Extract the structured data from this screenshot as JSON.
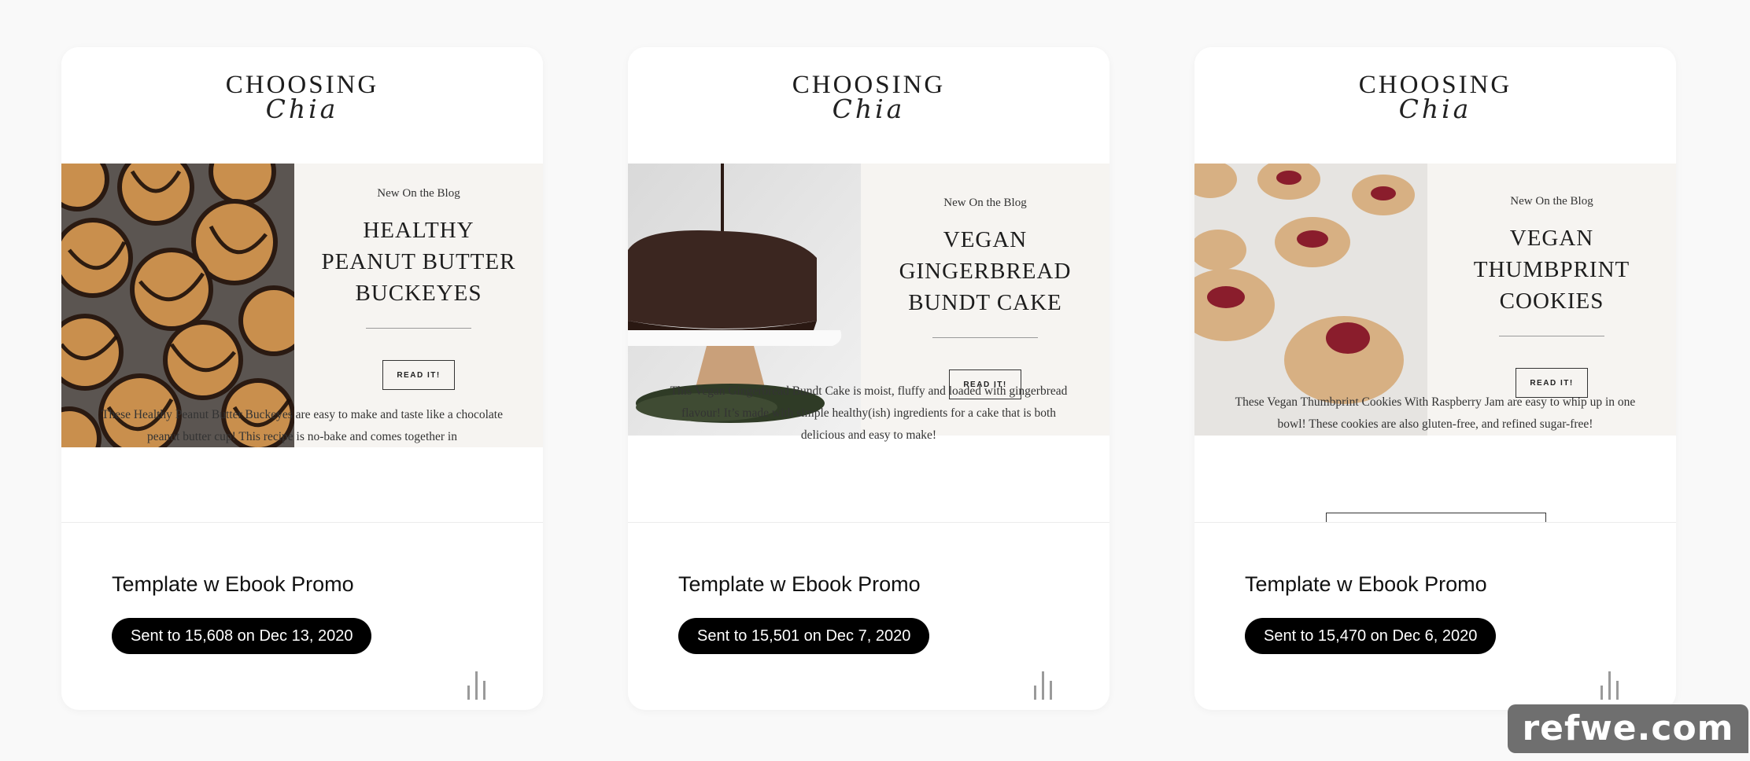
{
  "cards": [
    {
      "logo_word": "CHOOSING",
      "logo_script": "Chia",
      "kicker": "New On the Blog",
      "post_title": "HEALTHY PEANUT BUTTER BUCKEYES",
      "read_label": "READ IT!",
      "excerpt": "These Healthy Peanut Butter Buckeyes are easy to make and taste like a chocolate peanut butter cup! This recipe is no-bake and comes together in",
      "template_name": "Template w Ebook Promo",
      "sent_status": "Sent to 15,608 on Dec 13, 2020",
      "stats_icon": "bar-chart-icon"
    },
    {
      "logo_word": "CHOOSING",
      "logo_script": "Chia",
      "kicker": "New On the Blog",
      "post_title": "VEGAN GINGERBREAD BUNDT CAKE",
      "read_label": "READ IT!",
      "excerpt": "This Vegan Gingerbread Bundt Cake is moist, fluffy and loaded with gingerbread flavour! It’s made with simple healthy(ish) ingredients for a cake that is both delicious and easy to make!",
      "template_name": "Template w Ebook Promo",
      "sent_status": "Sent to 15,501 on Dec 7, 2020",
      "stats_icon": "bar-chart-icon"
    },
    {
      "logo_word": "CHOOSING",
      "logo_script": "Chia",
      "kicker": "New On the Blog",
      "post_title": "VEGAN THUMBPRINT COOKIES",
      "read_label": "READ IT!",
      "excerpt": "These Vegan Thumbprint Cookies With Raspberry Jam are easy to whip up in one bowl! These cookies are also gluten-free, and refined sugar-free!",
      "template_name": "Template w Ebook Promo",
      "sent_status": "Sent to 15,470 on Dec 6, 2020",
      "stats_icon": "bar-chart-icon"
    }
  ],
  "watermark": "refwe.com",
  "colors": {
    "page_bg": "#f9f9f9",
    "card_bg": "#ffffff",
    "panel_bg": "#f6f4f1",
    "badge_bg": "#000000",
    "badge_text": "#ffffff",
    "stats_icon": "#9a9a9a"
  }
}
